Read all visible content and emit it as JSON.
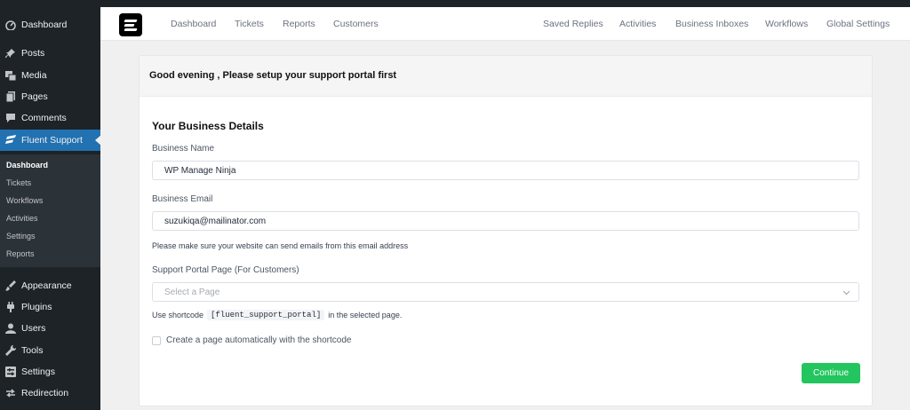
{
  "sidebar": {
    "items": [
      {
        "label": "Dashboard",
        "icon": "dashboard-icon"
      },
      {
        "label": "Posts",
        "icon": "pin-icon"
      },
      {
        "label": "Media",
        "icon": "media-icon"
      },
      {
        "label": "Pages",
        "icon": "pages-icon"
      },
      {
        "label": "Comments",
        "icon": "comment-icon"
      },
      {
        "label": "Fluent Support",
        "icon": "fluent-support-icon",
        "active": true
      },
      {
        "label": "Appearance",
        "icon": "brush-icon"
      },
      {
        "label": "Plugins",
        "icon": "plugin-icon"
      },
      {
        "label": "Users",
        "icon": "user-icon"
      },
      {
        "label": "Tools",
        "icon": "wrench-icon"
      },
      {
        "label": "Settings",
        "icon": "settings-icon"
      },
      {
        "label": "Redirection",
        "icon": "redirect-icon"
      }
    ],
    "submenu": [
      "Dashboard",
      "Tickets",
      "Workflows",
      "Activities",
      "Settings",
      "Reports"
    ]
  },
  "topnav": {
    "left_links": [
      "Dashboard",
      "Tickets",
      "Reports",
      "Customers"
    ],
    "right_links": [
      "Saved Replies",
      "Activities",
      "Business Inboxes",
      "Workflows",
      "Global Settings"
    ]
  },
  "card": {
    "header": "Good evening , Please setup your support portal first",
    "section_title": "Your Business Details",
    "business_name_label": "Business Name",
    "business_name_value": "WP Manage Ninja",
    "business_email_label": "Business Email",
    "business_email_value": "suzukiqa@mailinator.com",
    "email_help": "Please make sure your website can send emails from this email address",
    "portal_page_label": "Support Portal Page (For Customers)",
    "portal_page_placeholder": "Select a Page",
    "shortcode_prefix": "Use shortcode",
    "shortcode": "[fluent_support_portal]",
    "shortcode_suffix": "in the selected page.",
    "checkbox_label": "Create a page automatically with the shortcode",
    "continue_label": "Continue"
  },
  "colors": {
    "sidebar_bg": "#1d2327",
    "active_bg": "#2271b1",
    "accent_green": "#22c55e"
  }
}
